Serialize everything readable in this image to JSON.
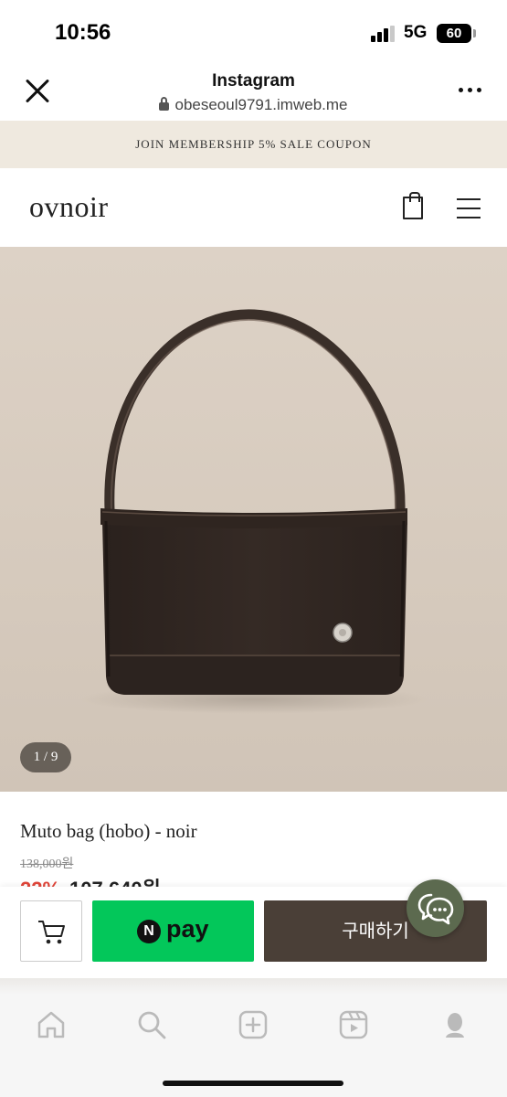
{
  "status_bar": {
    "time": "10:56",
    "network": "5G",
    "battery": "60"
  },
  "browser": {
    "title": "Instagram",
    "url": "obeseoul9791.imweb.me",
    "close_icon": "close-icon",
    "more_icon": "more-dots-icon"
  },
  "promo": {
    "text": "JOIN MEMBERSHIP 5% SALE COUPON"
  },
  "site": {
    "logo": "ovnoir",
    "cart_icon": "shopping-bag-icon",
    "menu_icon": "hamburger-menu-icon"
  },
  "product": {
    "image_alt": "hobo bag product photo",
    "image_counter": "1 / 9",
    "name": "Muto bag (hobo) - noir",
    "original_price": "138,000원",
    "discount": "22%",
    "price": "107,640원"
  },
  "actions": {
    "cart_icon": "cart-icon",
    "npay_badge": "N",
    "npay_label": "pay",
    "buy_label": "구매하기",
    "chat_icon": "chat-bubbles-icon"
  },
  "colors": {
    "promo_bg": "#efe9df",
    "npay_green": "#03c75a",
    "buy_brown": "#4a3f37",
    "chat_green": "#5c6a4f",
    "discount_red": "#e0463a"
  },
  "tab_bar": [
    "home-icon",
    "search-icon",
    "create-icon",
    "reels-icon",
    "profile-icon"
  ]
}
